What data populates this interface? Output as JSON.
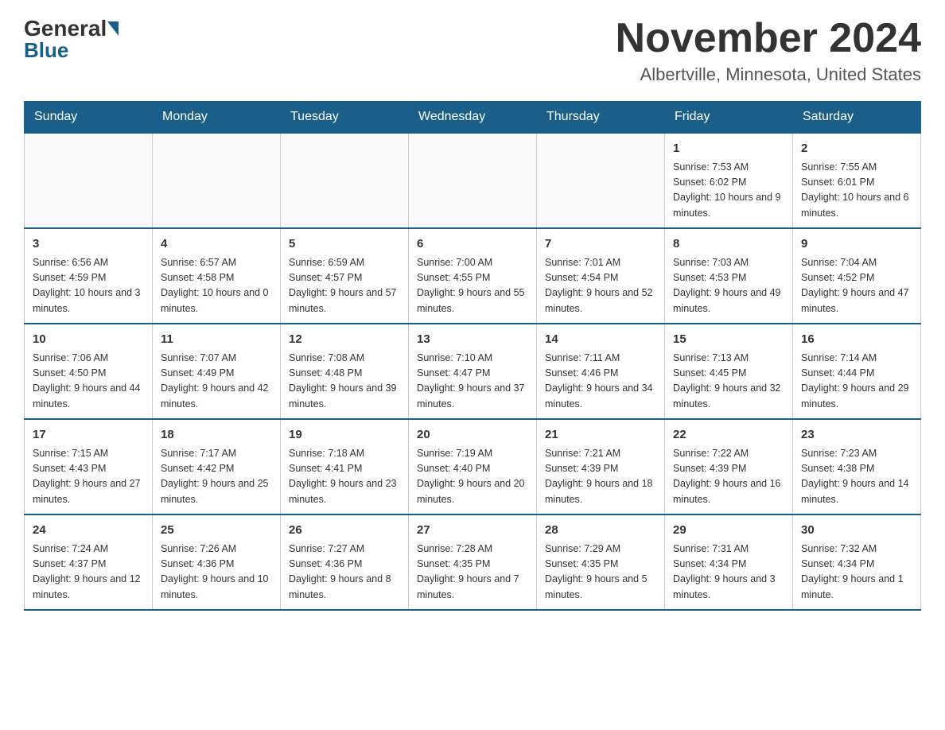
{
  "header": {
    "logo_general": "General",
    "logo_blue": "Blue",
    "month_title": "November 2024",
    "location": "Albertville, Minnesota, United States"
  },
  "days_of_week": [
    "Sunday",
    "Monday",
    "Tuesday",
    "Wednesday",
    "Thursday",
    "Friday",
    "Saturday"
  ],
  "weeks": [
    [
      {
        "day": "",
        "sunrise": "",
        "sunset": "",
        "daylight": ""
      },
      {
        "day": "",
        "sunrise": "",
        "sunset": "",
        "daylight": ""
      },
      {
        "day": "",
        "sunrise": "",
        "sunset": "",
        "daylight": ""
      },
      {
        "day": "",
        "sunrise": "",
        "sunset": "",
        "daylight": ""
      },
      {
        "day": "",
        "sunrise": "",
        "sunset": "",
        "daylight": ""
      },
      {
        "day": "1",
        "sunrise": "Sunrise: 7:53 AM",
        "sunset": "Sunset: 6:02 PM",
        "daylight": "Daylight: 10 hours and 9 minutes."
      },
      {
        "day": "2",
        "sunrise": "Sunrise: 7:55 AM",
        "sunset": "Sunset: 6:01 PM",
        "daylight": "Daylight: 10 hours and 6 minutes."
      }
    ],
    [
      {
        "day": "3",
        "sunrise": "Sunrise: 6:56 AM",
        "sunset": "Sunset: 4:59 PM",
        "daylight": "Daylight: 10 hours and 3 minutes."
      },
      {
        "day": "4",
        "sunrise": "Sunrise: 6:57 AM",
        "sunset": "Sunset: 4:58 PM",
        "daylight": "Daylight: 10 hours and 0 minutes."
      },
      {
        "day": "5",
        "sunrise": "Sunrise: 6:59 AM",
        "sunset": "Sunset: 4:57 PM",
        "daylight": "Daylight: 9 hours and 57 minutes."
      },
      {
        "day": "6",
        "sunrise": "Sunrise: 7:00 AM",
        "sunset": "Sunset: 4:55 PM",
        "daylight": "Daylight: 9 hours and 55 minutes."
      },
      {
        "day": "7",
        "sunrise": "Sunrise: 7:01 AM",
        "sunset": "Sunset: 4:54 PM",
        "daylight": "Daylight: 9 hours and 52 minutes."
      },
      {
        "day": "8",
        "sunrise": "Sunrise: 7:03 AM",
        "sunset": "Sunset: 4:53 PM",
        "daylight": "Daylight: 9 hours and 49 minutes."
      },
      {
        "day": "9",
        "sunrise": "Sunrise: 7:04 AM",
        "sunset": "Sunset: 4:52 PM",
        "daylight": "Daylight: 9 hours and 47 minutes."
      }
    ],
    [
      {
        "day": "10",
        "sunrise": "Sunrise: 7:06 AM",
        "sunset": "Sunset: 4:50 PM",
        "daylight": "Daylight: 9 hours and 44 minutes."
      },
      {
        "day": "11",
        "sunrise": "Sunrise: 7:07 AM",
        "sunset": "Sunset: 4:49 PM",
        "daylight": "Daylight: 9 hours and 42 minutes."
      },
      {
        "day": "12",
        "sunrise": "Sunrise: 7:08 AM",
        "sunset": "Sunset: 4:48 PM",
        "daylight": "Daylight: 9 hours and 39 minutes."
      },
      {
        "day": "13",
        "sunrise": "Sunrise: 7:10 AM",
        "sunset": "Sunset: 4:47 PM",
        "daylight": "Daylight: 9 hours and 37 minutes."
      },
      {
        "day": "14",
        "sunrise": "Sunrise: 7:11 AM",
        "sunset": "Sunset: 4:46 PM",
        "daylight": "Daylight: 9 hours and 34 minutes."
      },
      {
        "day": "15",
        "sunrise": "Sunrise: 7:13 AM",
        "sunset": "Sunset: 4:45 PM",
        "daylight": "Daylight: 9 hours and 32 minutes."
      },
      {
        "day": "16",
        "sunrise": "Sunrise: 7:14 AM",
        "sunset": "Sunset: 4:44 PM",
        "daylight": "Daylight: 9 hours and 29 minutes."
      }
    ],
    [
      {
        "day": "17",
        "sunrise": "Sunrise: 7:15 AM",
        "sunset": "Sunset: 4:43 PM",
        "daylight": "Daylight: 9 hours and 27 minutes."
      },
      {
        "day": "18",
        "sunrise": "Sunrise: 7:17 AM",
        "sunset": "Sunset: 4:42 PM",
        "daylight": "Daylight: 9 hours and 25 minutes."
      },
      {
        "day": "19",
        "sunrise": "Sunrise: 7:18 AM",
        "sunset": "Sunset: 4:41 PM",
        "daylight": "Daylight: 9 hours and 23 minutes."
      },
      {
        "day": "20",
        "sunrise": "Sunrise: 7:19 AM",
        "sunset": "Sunset: 4:40 PM",
        "daylight": "Daylight: 9 hours and 20 minutes."
      },
      {
        "day": "21",
        "sunrise": "Sunrise: 7:21 AM",
        "sunset": "Sunset: 4:39 PM",
        "daylight": "Daylight: 9 hours and 18 minutes."
      },
      {
        "day": "22",
        "sunrise": "Sunrise: 7:22 AM",
        "sunset": "Sunset: 4:39 PM",
        "daylight": "Daylight: 9 hours and 16 minutes."
      },
      {
        "day": "23",
        "sunrise": "Sunrise: 7:23 AM",
        "sunset": "Sunset: 4:38 PM",
        "daylight": "Daylight: 9 hours and 14 minutes."
      }
    ],
    [
      {
        "day": "24",
        "sunrise": "Sunrise: 7:24 AM",
        "sunset": "Sunset: 4:37 PM",
        "daylight": "Daylight: 9 hours and 12 minutes."
      },
      {
        "day": "25",
        "sunrise": "Sunrise: 7:26 AM",
        "sunset": "Sunset: 4:36 PM",
        "daylight": "Daylight: 9 hours and 10 minutes."
      },
      {
        "day": "26",
        "sunrise": "Sunrise: 7:27 AM",
        "sunset": "Sunset: 4:36 PM",
        "daylight": "Daylight: 9 hours and 8 minutes."
      },
      {
        "day": "27",
        "sunrise": "Sunrise: 7:28 AM",
        "sunset": "Sunset: 4:35 PM",
        "daylight": "Daylight: 9 hours and 7 minutes."
      },
      {
        "day": "28",
        "sunrise": "Sunrise: 7:29 AM",
        "sunset": "Sunset: 4:35 PM",
        "daylight": "Daylight: 9 hours and 5 minutes."
      },
      {
        "day": "29",
        "sunrise": "Sunrise: 7:31 AM",
        "sunset": "Sunset: 4:34 PM",
        "daylight": "Daylight: 9 hours and 3 minutes."
      },
      {
        "day": "30",
        "sunrise": "Sunrise: 7:32 AM",
        "sunset": "Sunset: 4:34 PM",
        "daylight": "Daylight: 9 hours and 1 minute."
      }
    ]
  ]
}
